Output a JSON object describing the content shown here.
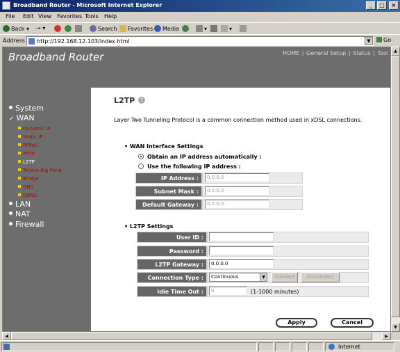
{
  "window": {
    "title": "Broadband Router - Microsoft Internet Explorer"
  },
  "menu": [
    "File",
    "Edit",
    "View",
    "Favorites",
    "Tools",
    "Help"
  ],
  "toolbar": {
    "back": "Back",
    "search": "Search",
    "favorites": "Favorites",
    "media": "Media"
  },
  "address": {
    "label": "Address",
    "url": "http://192.168.12.103/index.html",
    "go": "Go"
  },
  "header": {
    "brand": "Broadband Router",
    "nav": [
      "HOME",
      "General Setup",
      "Status",
      "Tool"
    ]
  },
  "sidebar": {
    "main": [
      "System",
      "WAN",
      "LAN",
      "NAT",
      "Firewall"
    ],
    "sub": [
      "Dynamic IP",
      "Static IP",
      "PPPoE",
      "PPTP",
      "L2TP",
      "Telstra Big Pond",
      "Bridge",
      "DNS",
      "DDNS"
    ]
  },
  "page": {
    "title": "L2TP",
    "description": "Layer Two Tunneling Protocol is a common connection method used in xDSL connections."
  },
  "wan": {
    "heading": "WAN Interface Settings",
    "opt_auto": "Obtain an IP address automatically :",
    "opt_manual": "Use the following IP address :",
    "ip_label": "IP Address :",
    "ip_value": "0.0.0.0",
    "mask_label": "Subnet Mask :",
    "mask_value": "0.0.0.0",
    "gw_label": "Default Gateway :",
    "gw_value": "0.0.0.0"
  },
  "l2tp": {
    "heading": "L2TP Settings",
    "user_label": "User ID :",
    "user_value": "",
    "pass_label": "Password :",
    "pass_value": "",
    "gw_label": "L2TP Gateway :",
    "gw_value": "0.0.0.0",
    "conn_label": "Connection Type :",
    "conn_value": "Continuous",
    "connect": "Connect",
    "disconnect": "Disconnect",
    "idle_label": "Idle Time Out :",
    "idle_value": "0",
    "idle_hint": "(1-1000 minutes)"
  },
  "buttons": {
    "apply": "Apply",
    "cancel": "Cancel"
  },
  "status": {
    "zone": "Internet"
  }
}
